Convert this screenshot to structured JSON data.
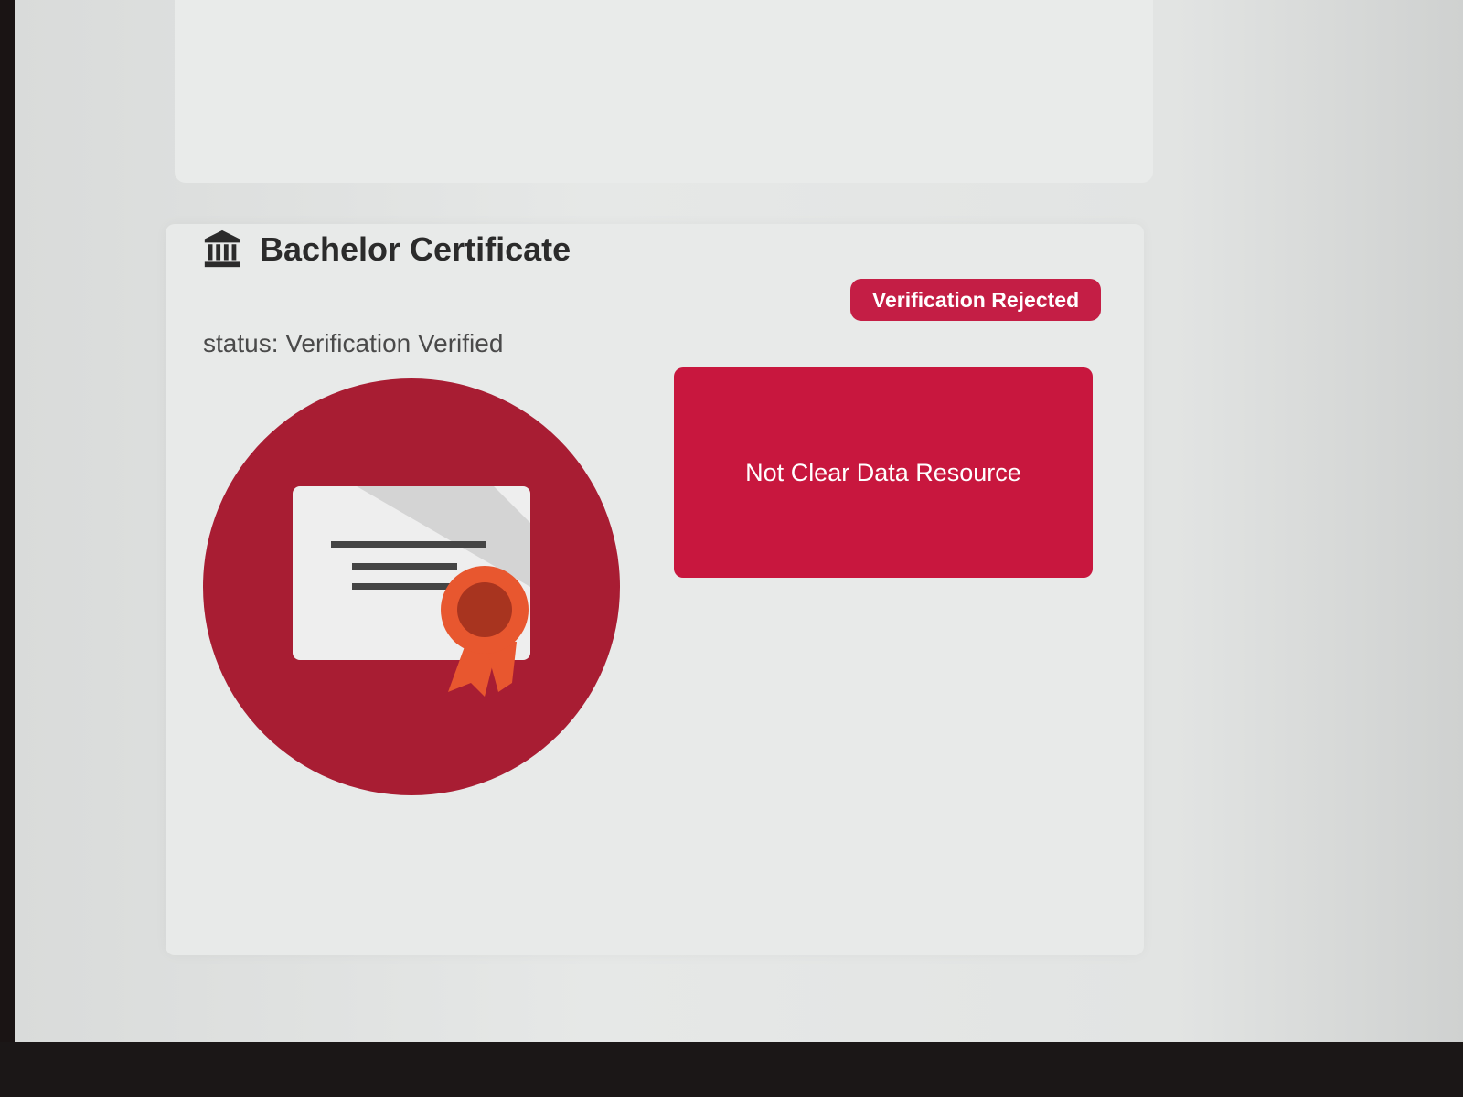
{
  "card": {
    "title": "Bachelor Certificate",
    "status_text": "status: Verification Verified",
    "badge": "Verification Rejected",
    "notice": "Not Clear Data Resource"
  },
  "colors": {
    "accent": "#c41e45",
    "notice_bg": "#c8173e",
    "circle": "#a81d33"
  }
}
